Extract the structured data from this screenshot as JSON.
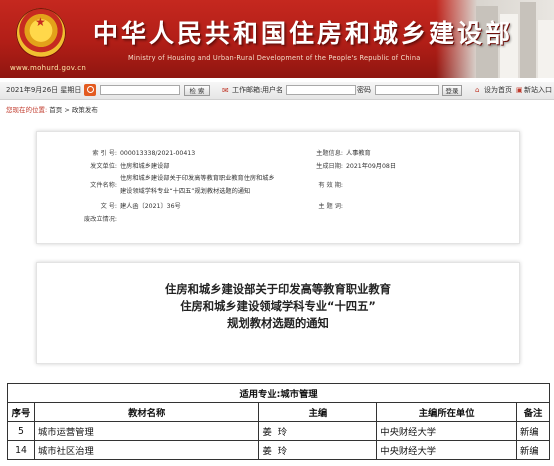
{
  "header": {
    "site_url": "www.mohurd.gov.cn",
    "title": "中华人民共和国住房和城乡建设部",
    "subtitle": "Ministry of Housing and Urban-Rural Development of the People's Republic of China"
  },
  "toolbar": {
    "date": "2021年9月26日 星期日",
    "search_button": "检 索",
    "mail_label": "工作邮箱:",
    "username_label": "用户名",
    "password_label": "密码",
    "login_button": "登录",
    "set_homepage": "设为首页",
    "new_window": "新站入口"
  },
  "breadcrumb": {
    "label": "您现在的位置:",
    "path": "首页 > 政策发布"
  },
  "meta": {
    "index_no_label": "索 引 号:",
    "index_no": "000013338/2021-00413",
    "issuer_label": "发文单位:",
    "issuer": "住房和城乡建设部",
    "doc_name_label": "文件名称:",
    "doc_name_line1": "住房和城乡建设部关于印发高等教育职业教育住房和城乡",
    "doc_name_line2": "建设领域学科专业“十四五”规划教材选题的通知",
    "doc_no_label": "文    号:",
    "doc_no": "建人函〔2021〕36号",
    "status_label": "废改立情况:",
    "category_label": "主题信息:",
    "category": "人事教育",
    "date_label": "生成日期:",
    "date": "2021年09月08日",
    "validity_label": "有 效 期:",
    "keywords_label": "主 题 词:"
  },
  "doc_title": {
    "line1": "住房和城乡建设部关于印发高等教育职业教育",
    "line2": "住房和城乡建设领域学科专业“十四五”",
    "line3": "规划教材选题的通知"
  },
  "table": {
    "caption": "适用专业:城市管理",
    "headers": [
      "序号",
      "教材名称",
      "主编",
      "主编所在单位",
      "备注"
    ],
    "rows": [
      [
        "5",
        "城市运营管理",
        "姜  玲",
        "中央财经大学",
        "新编"
      ],
      [
        "14",
        "城市社区治理",
        "姜  玲",
        "中央财经大学",
        "新编"
      ]
    ]
  },
  "colors": {
    "banner_red": "#b11e17",
    "link_red": "#c0392b"
  }
}
